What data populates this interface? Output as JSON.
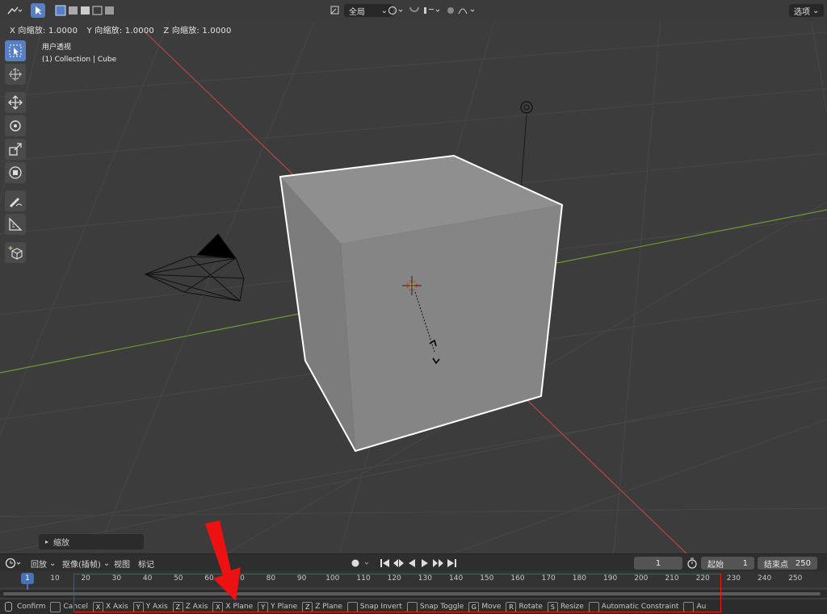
{
  "header": {
    "transform_orientation": "全局",
    "options_label": "选项"
  },
  "operation_info": {
    "x_scale": "X 向缩放: 1.0000",
    "y_scale": "Y 向缩放: 1.0000",
    "z_scale": "Z 向缩放: 1.0000"
  },
  "view_info": {
    "view_name": "用户透视",
    "collection": "(1) Collection | Cube"
  },
  "last_operation": {
    "label": "缩放"
  },
  "timeline": {
    "playback_label": "回放",
    "keying_label": "抠像(插帧)",
    "view_label": "视图",
    "marker_label": "标记",
    "current_frame": "1",
    "start_label": "起始",
    "start_value": "1",
    "end_label": "结束点",
    "end_value": "250",
    "frame_indicator": "1",
    "ticks": [
      "10",
      "20",
      "30",
      "40",
      "50",
      "60",
      "70",
      "80",
      "90",
      "100",
      "110",
      "120",
      "130",
      "140",
      "150",
      "160",
      "170",
      "180",
      "190",
      "200",
      "210",
      "220",
      "230",
      "240",
      "250"
    ]
  },
  "status_bar": {
    "items": [
      {
        "key": "",
        "label": "Confirm"
      },
      {
        "key": "",
        "label": "Cancel"
      },
      {
        "key": "X",
        "label": "X Axis"
      },
      {
        "key": "Y",
        "label": "Y Axis"
      },
      {
        "key": "Z",
        "label": "Z Axis"
      },
      {
        "key": "X",
        "label": "X Plane"
      },
      {
        "key": "Y",
        "label": "Y Plane"
      },
      {
        "key": "Z",
        "label": "Z Plane"
      },
      {
        "key": "",
        "label": "Snap Invert"
      },
      {
        "key": "",
        "label": "Snap Toggle"
      },
      {
        "key": "G",
        "label": "Move"
      },
      {
        "key": "R",
        "label": "Rotate"
      },
      {
        "key": "S",
        "label": "Resize"
      },
      {
        "key": "",
        "label": "Automatic Constraint"
      },
      {
        "key": "",
        "label": "Au"
      }
    ]
  },
  "colors": {
    "accent": "#4772b3",
    "highlight": "#e02020",
    "axis_x": "#c04040",
    "axis_y": "#70a030"
  }
}
